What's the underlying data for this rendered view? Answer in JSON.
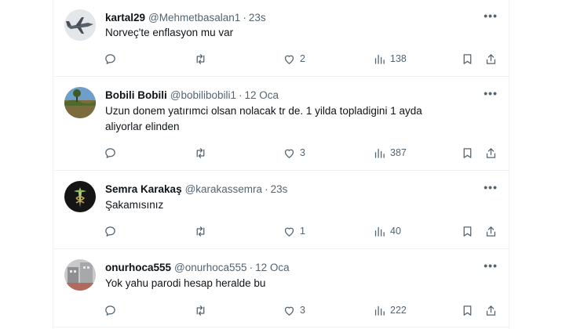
{
  "tweets": [
    {
      "name": "kartal29",
      "handle": "@Mehmetbasalan1",
      "dot": "·",
      "time": "23s",
      "text_lines": [
        "Norveç'te enflasyon mu var"
      ],
      "replies": "",
      "retweets": "",
      "likes": "2",
      "views": "138"
    },
    {
      "name": "Bobili Bobili",
      "handle": "@bobilibobili1",
      "dot": "·",
      "time": "12 Oca",
      "text_lines": [
        "Uzun donem yatırımci olsan nolacak tr de. 1 yilda topladigini 1 ayda",
        "aliyorlar elinden"
      ],
      "replies": "",
      "retweets": "",
      "likes": "3",
      "views": "387"
    },
    {
      "name": "Semra Karakaş",
      "handle": "@karakassemra",
      "dot": "·",
      "time": "23s",
      "text_lines": [
        "Şakamısınız"
      ],
      "replies": "",
      "retweets": "",
      "likes": "1",
      "views": "40"
    },
    {
      "name": "onurhoca555",
      "handle": "@onurhoca555",
      "dot": "·",
      "time": "12 Oca",
      "text_lines": [
        "Yok yahu parodi hesap heralde bu"
      ],
      "replies": "",
      "retweets": "",
      "likes": "3",
      "views": "222"
    }
  ],
  "more_label": "•••",
  "icons": {
    "reply": "reply-icon",
    "retweet": "retweet-icon",
    "like": "heart-icon",
    "views": "views-icon",
    "bookmark": "bookmark-icon",
    "share": "share-icon"
  },
  "colors": {
    "text": "#0f1419",
    "secondary": "#536471",
    "divider": "#eff3f4"
  }
}
